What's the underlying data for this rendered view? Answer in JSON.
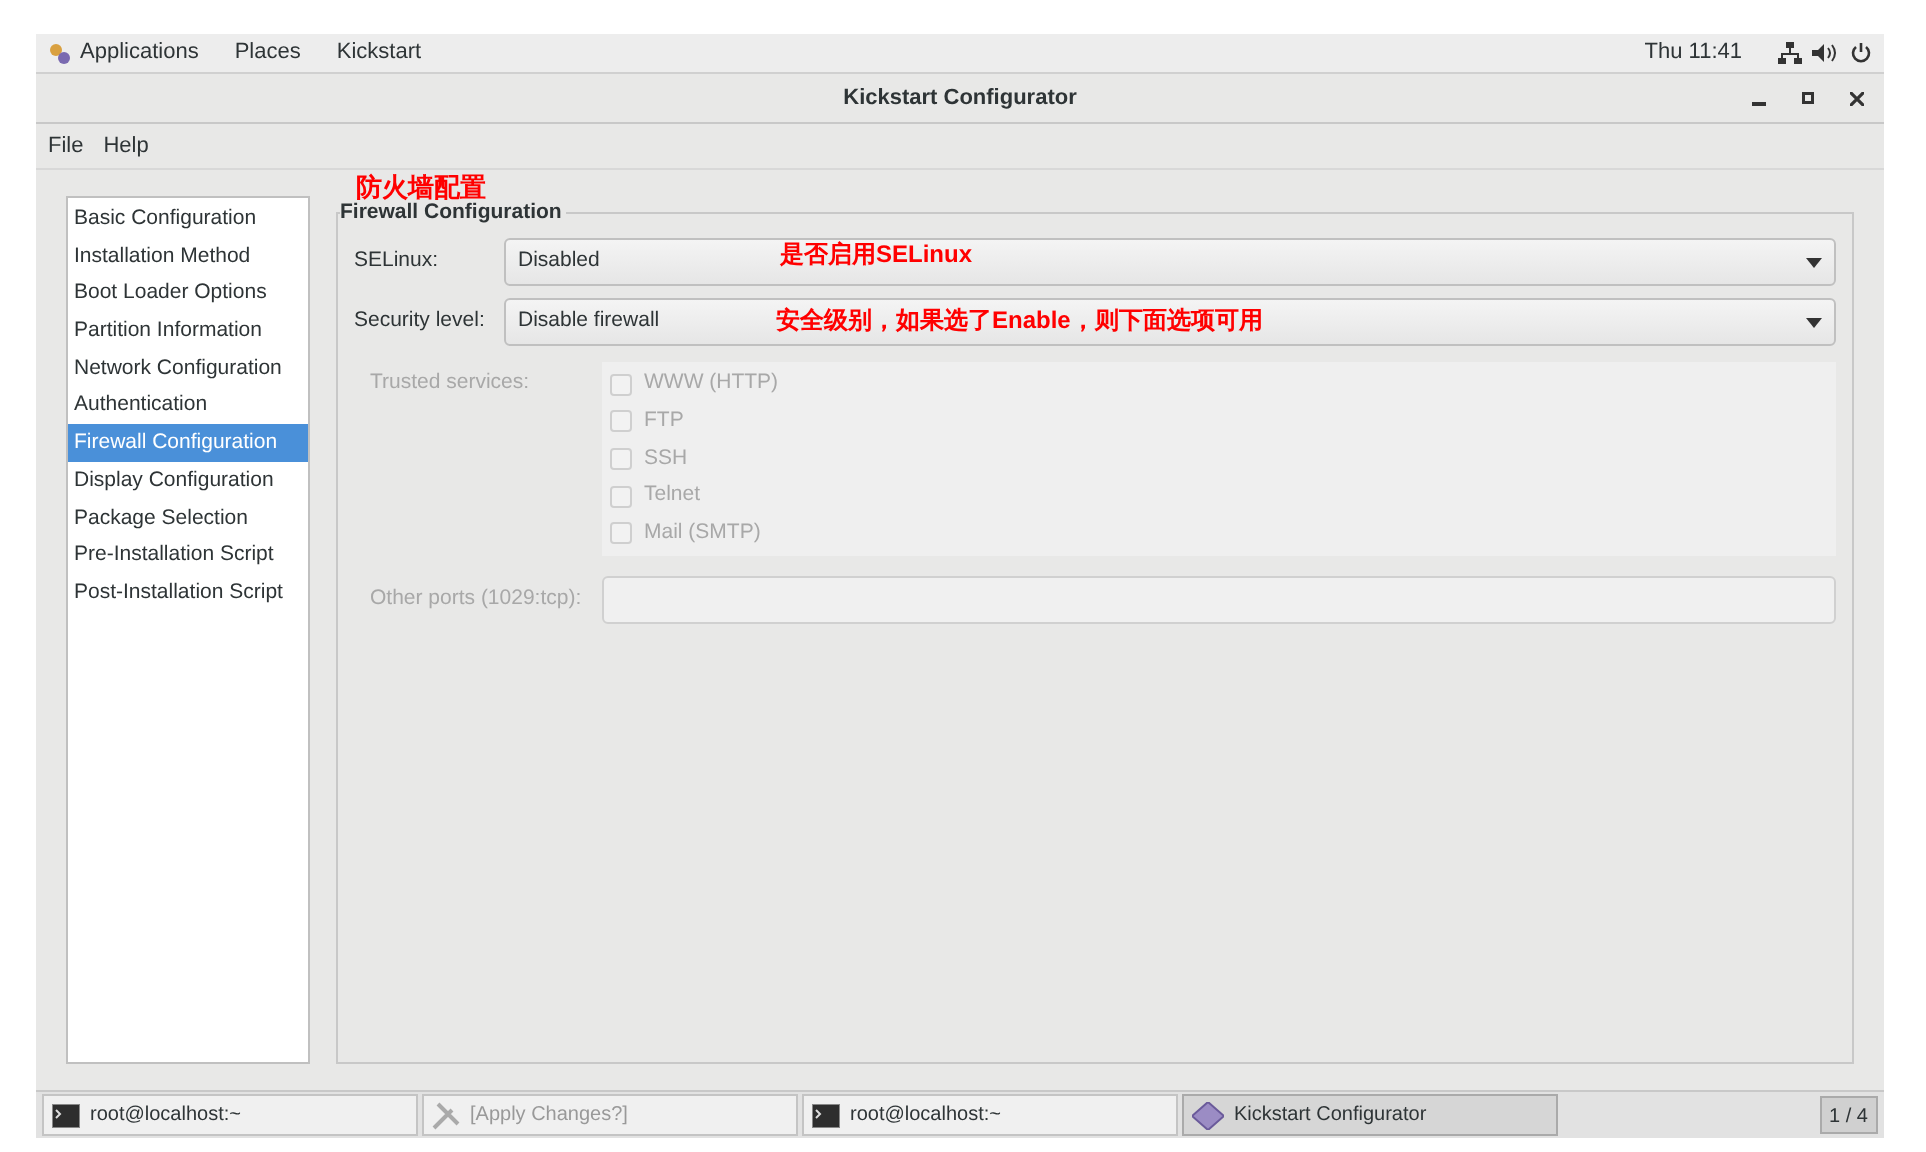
{
  "top_bar": {
    "menus": [
      "Applications",
      "Places",
      "Kickstart"
    ],
    "clock": "Thu 11:41"
  },
  "window": {
    "title": "Kickstart Configurator"
  },
  "menu_bar": [
    "File",
    "Help"
  ],
  "sidebar": {
    "items": [
      {
        "label": "Basic Configuration",
        "selected": false
      },
      {
        "label": "Installation Method",
        "selected": false
      },
      {
        "label": "Boot Loader Options",
        "selected": false
      },
      {
        "label": "Partition Information",
        "selected": false
      },
      {
        "label": "Network Configuration",
        "selected": false
      },
      {
        "label": "Authentication",
        "selected": false
      },
      {
        "label": "Firewall Configuration",
        "selected": true
      },
      {
        "label": "Display Configuration",
        "selected": false
      },
      {
        "label": "Package Selection",
        "selected": false
      },
      {
        "label": "Pre-Installation Script",
        "selected": false
      },
      {
        "label": "Post-Installation Script",
        "selected": false
      }
    ]
  },
  "panel": {
    "title": "Firewall Configuration",
    "selinux": {
      "label": "SELinux:",
      "value": "Disabled"
    },
    "security_level": {
      "label": "Security level:",
      "value": "Disable firewall"
    },
    "trusted_services": {
      "label": "Trusted services:",
      "disabled": true,
      "items": [
        {
          "label": "WWW (HTTP)",
          "checked": false
        },
        {
          "label": "FTP",
          "checked": false
        },
        {
          "label": "SSH",
          "checked": false
        },
        {
          "label": "Telnet",
          "checked": false
        },
        {
          "label": "Mail (SMTP)",
          "checked": false
        }
      ]
    },
    "other_ports": {
      "label": "Other ports (1029:tcp):",
      "disabled": true
    }
  },
  "annotations": [
    {
      "kind": "title",
      "text": "防火墙配置"
    },
    {
      "kind": "selinux",
      "text": "是否启用SELinux"
    },
    {
      "kind": "security",
      "text": "安全级别，如果选了Enable，则下面选项可用"
    }
  ],
  "taskbar": {
    "items": [
      {
        "kind": "terminal",
        "label": "root@localhost:~",
        "selected": false
      },
      {
        "kind": "tools",
        "label": "[Apply Changes?]",
        "selected": false
      },
      {
        "kind": "terminal",
        "label": "root@localhost:~",
        "selected": false
      },
      {
        "kind": "kickstart",
        "label": "Kickstart Configurator",
        "selected": true
      }
    ],
    "pager": "1 / 4"
  }
}
